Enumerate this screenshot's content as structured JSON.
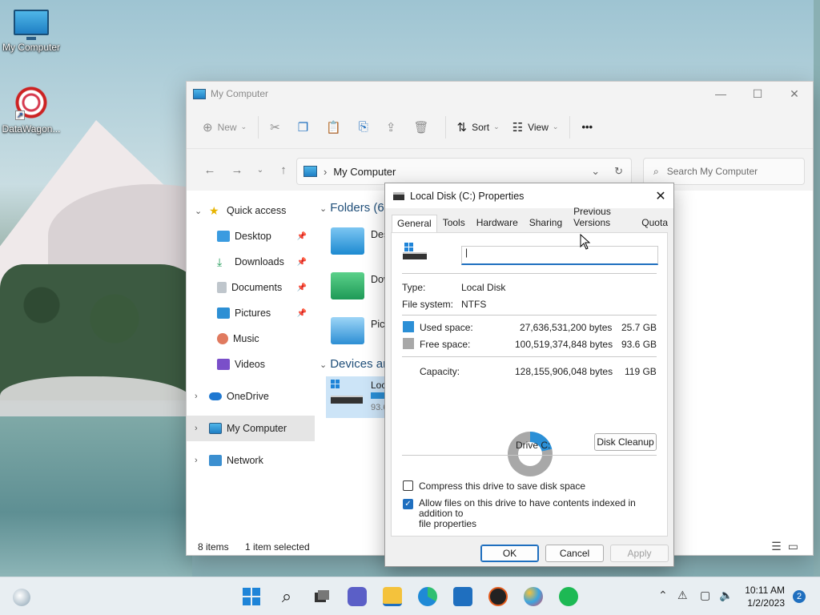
{
  "desktop": {
    "icons": [
      {
        "label": "My Computer"
      },
      {
        "label": "DataWagon..."
      }
    ]
  },
  "explorer": {
    "title": "My Computer",
    "toolbar": {
      "new_label": "New",
      "sort_label": "Sort",
      "view_label": "View",
      "more_label": "•••"
    },
    "address": {
      "path": "My Computer"
    },
    "search": {
      "placeholder": "Search My Computer"
    },
    "sidebar": {
      "quick_access": "Quick access",
      "items": [
        {
          "label": "Desktop"
        },
        {
          "label": "Downloads"
        },
        {
          "label": "Documents"
        },
        {
          "label": "Pictures"
        },
        {
          "label": "Music"
        },
        {
          "label": "Videos"
        }
      ],
      "onedrive": "OneDrive",
      "my_computer": "My Computer",
      "network": "Network"
    },
    "content": {
      "folders_header": "Folders (6)",
      "folder1": "Des",
      "folder2": "Dow",
      "folder3": "Pict",
      "devices_header": "Devices ar",
      "drive_short": "Loca",
      "drive_free_short": "93.6"
    },
    "status": {
      "items": "8 items",
      "selected": "1 item selected"
    }
  },
  "dialog": {
    "title": "Local Disk (C:) Properties",
    "tabs": [
      "General",
      "Tools",
      "Hardware",
      "Sharing",
      "Previous Versions",
      "Quota"
    ],
    "name_value": "|",
    "type_label": "Type:",
    "type_value": "Local Disk",
    "fs_label": "File system:",
    "fs_value": "NTFS",
    "used_label": "Used space:",
    "used_bytes": "27,636,531,200 bytes",
    "used_gb": "25.7 GB",
    "free_label": "Free space:",
    "free_bytes": "100,519,374,848 bytes",
    "free_gb": "93.6 GB",
    "cap_label": "Capacity:",
    "cap_bytes": "128,155,906,048 bytes",
    "cap_gb": "119 GB",
    "drive_label": "Drive C:",
    "cleanup_label": "Disk Cleanup",
    "compress_label": "Compress this drive to save disk space",
    "index_label_1": "Allow files on this drive to have contents indexed in addition to",
    "index_label_2": "file properties",
    "ok_label": "OK",
    "cancel_label": "Cancel",
    "apply_label": "Apply",
    "used_fraction": 0.215,
    "colors": {
      "used": "#2b8fd6",
      "free": "#a8a8a8"
    }
  },
  "taskbar": {
    "time": "10:11 AM",
    "date": "1/2/2023",
    "notifications": "2"
  }
}
